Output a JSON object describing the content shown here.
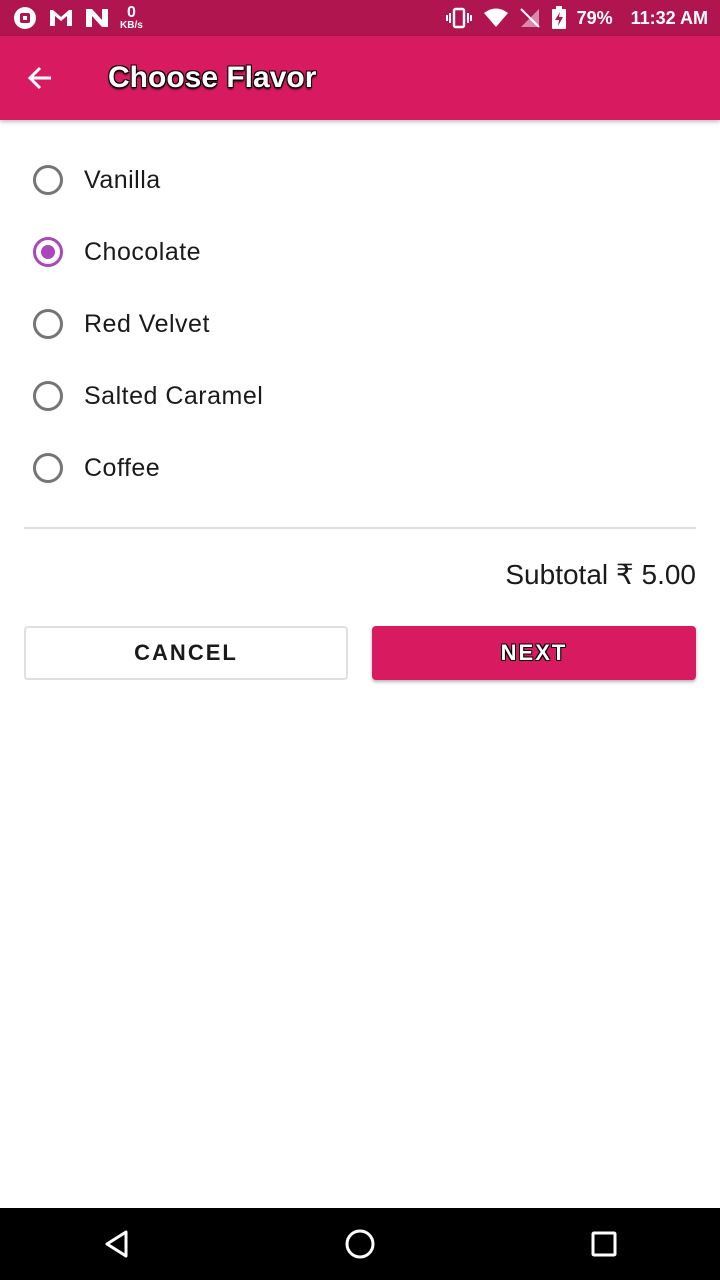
{
  "status_bar": {
    "network_speed_value": "0",
    "network_speed_unit": "KB/s",
    "battery_percent": "79%",
    "time": "11:32 AM",
    "left_icons": [
      "notification-app-icon",
      "gmail-icon",
      "app-n-icon"
    ],
    "right_icons": [
      "vibrate-icon",
      "wifi-icon",
      "no-signal-icon",
      "battery-charging-icon"
    ]
  },
  "app_bar": {
    "title": "Choose Flavor",
    "back_icon": "arrow-back-icon",
    "color": "#d81b60"
  },
  "flavors": {
    "options": [
      {
        "label": "Vanilla",
        "selected": false
      },
      {
        "label": "Chocolate",
        "selected": true
      },
      {
        "label": "Red Velvet",
        "selected": false
      },
      {
        "label": "Salted Caramel",
        "selected": false
      },
      {
        "label": "Coffee",
        "selected": false
      }
    ],
    "accent_color": "#ab47bc"
  },
  "summary": {
    "subtotal": "Subtotal ₹ 5.00"
  },
  "actions": {
    "cancel_label": "CANCEL",
    "next_label": "NEXT"
  },
  "nav_bar": {
    "icons": [
      "back-triangle-icon",
      "home-circle-icon",
      "recents-square-icon"
    ]
  }
}
